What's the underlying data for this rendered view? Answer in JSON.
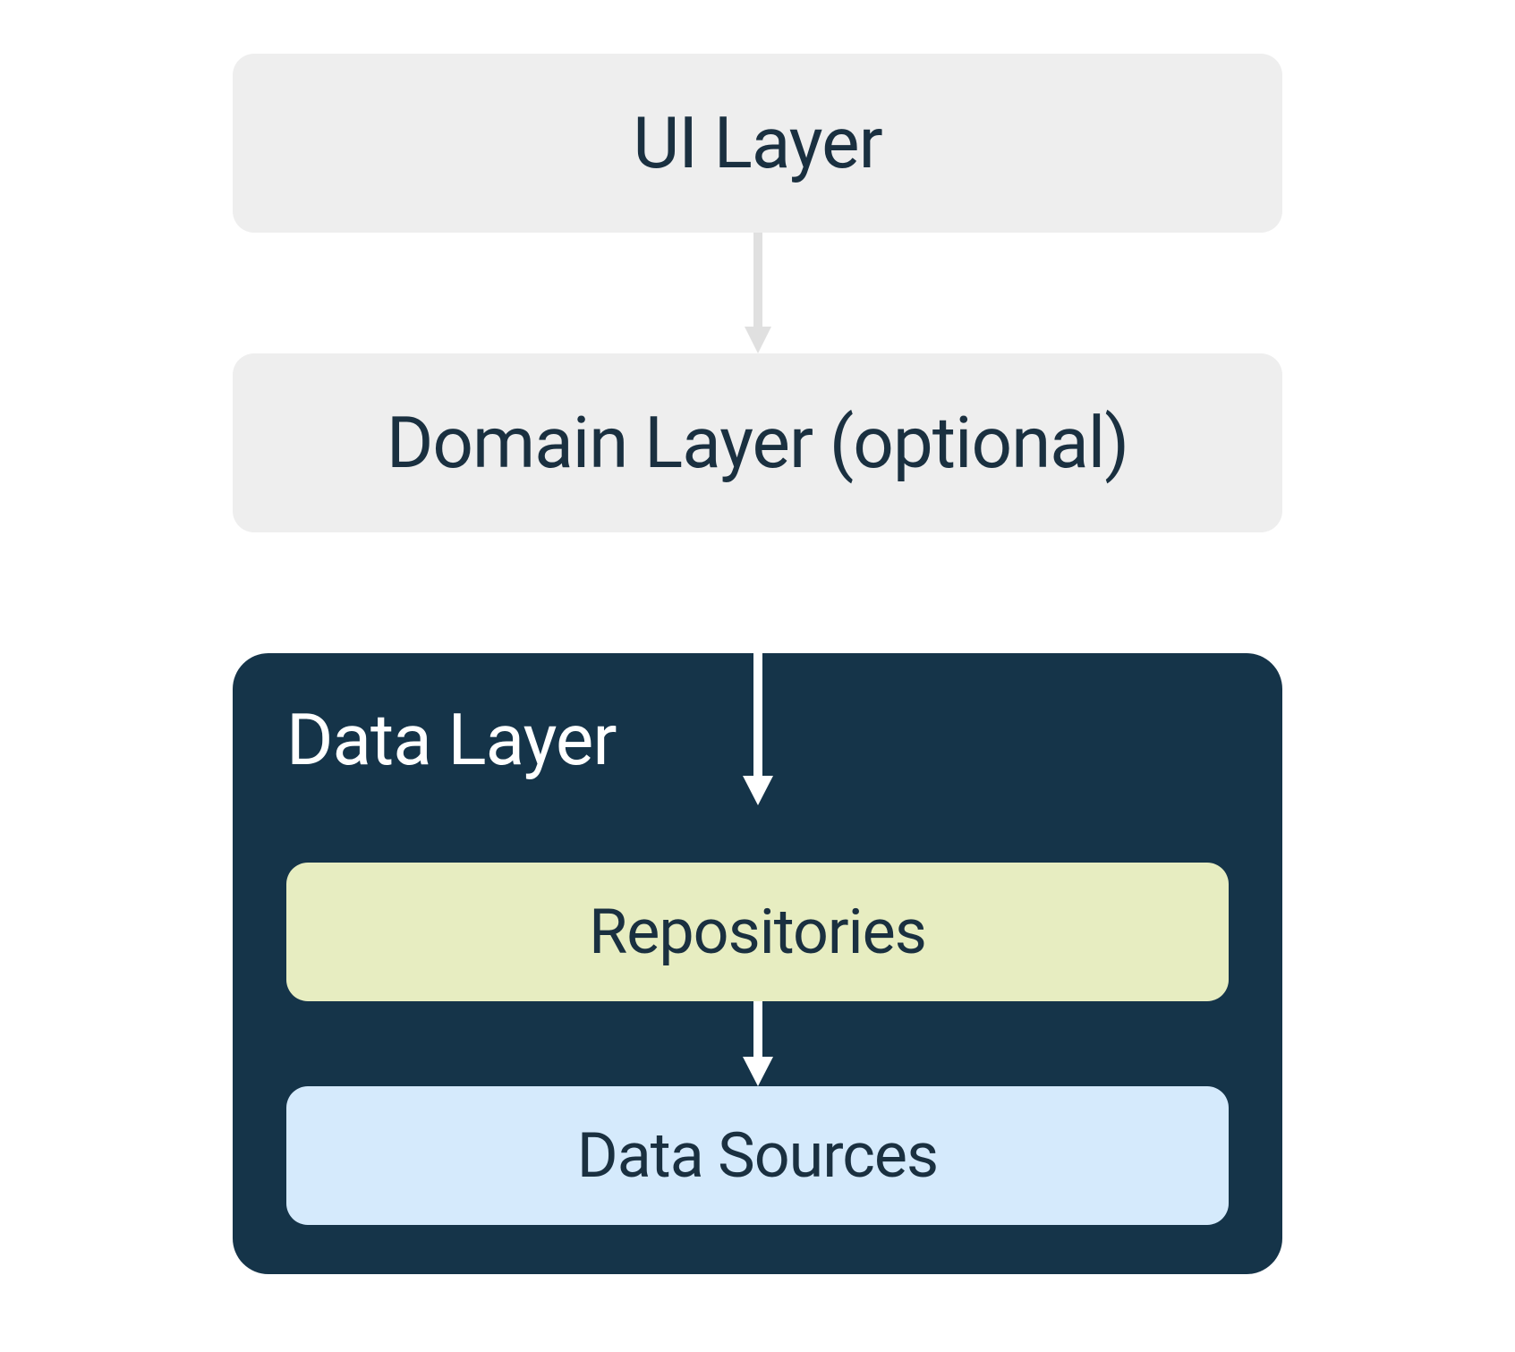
{
  "layers": {
    "ui": {
      "label": "UI Layer"
    },
    "domain": {
      "label": "Domain Layer (optional)"
    },
    "data": {
      "title": "Data Layer",
      "repositories": {
        "label": "Repositories"
      },
      "dataSources": {
        "label": "Data Sources"
      }
    }
  },
  "colors": {
    "lightGray": "#eeeeee",
    "darkNavy": "#153449",
    "textDark": "#1a3040",
    "paleGreen": "#e7edc1",
    "paleBlue": "#d5eafc",
    "arrowLight": "#e0e0e0",
    "arrowWhite": "#ffffff"
  },
  "chart_data": {
    "type": "diagram",
    "title": "Android App Architecture Layers",
    "nodes": [
      {
        "id": "ui",
        "label": "UI Layer",
        "color": "#eeeeee"
      },
      {
        "id": "domain",
        "label": "Domain Layer (optional)",
        "color": "#eeeeee"
      },
      {
        "id": "data",
        "label": "Data Layer",
        "color": "#153449",
        "children": [
          {
            "id": "repositories",
            "label": "Repositories",
            "color": "#e7edc1"
          },
          {
            "id": "dataSources",
            "label": "Data Sources",
            "color": "#d5eafc"
          }
        ]
      }
    ],
    "edges": [
      {
        "from": "ui",
        "to": "domain"
      },
      {
        "from": "domain",
        "to": "repositories"
      },
      {
        "from": "repositories",
        "to": "dataSources"
      }
    ]
  }
}
